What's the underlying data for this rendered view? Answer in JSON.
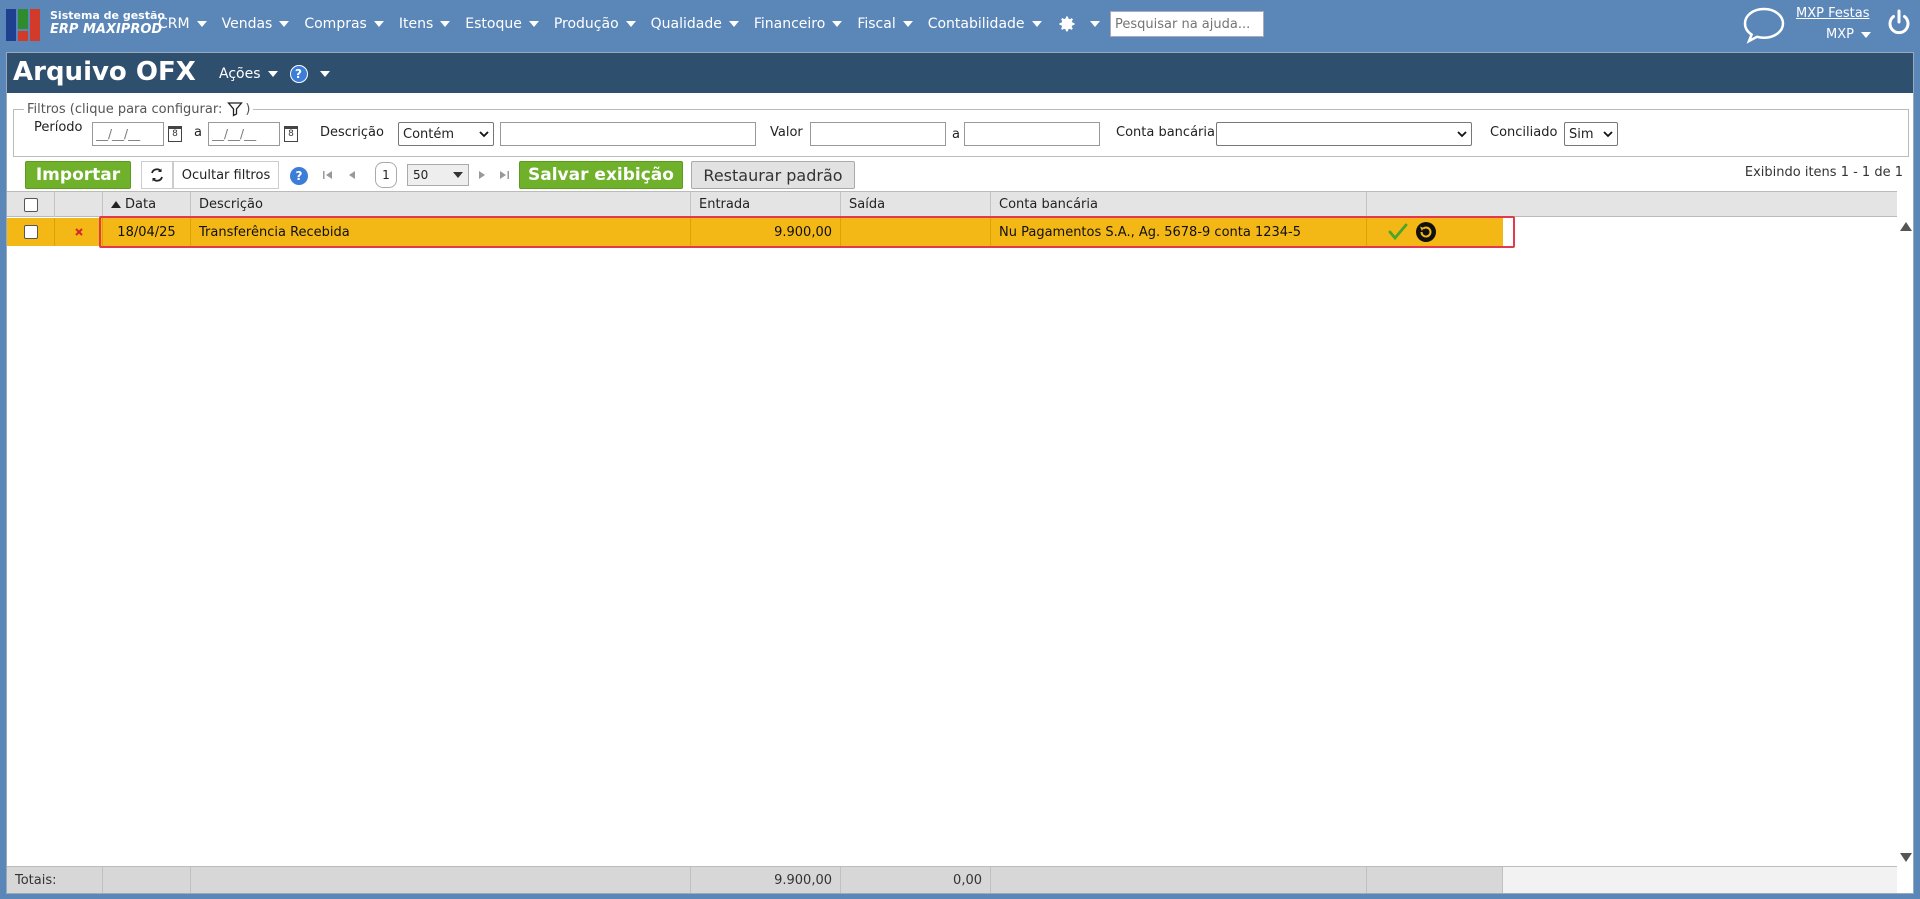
{
  "brand": {
    "line1": "Sistema de gestão",
    "line2": "ERP MAXIPROD"
  },
  "menu": [
    {
      "label": "CRM"
    },
    {
      "label": "Vendas"
    },
    {
      "label": "Compras"
    },
    {
      "label": "Itens"
    },
    {
      "label": "Estoque"
    },
    {
      "label": "Produção"
    },
    {
      "label": "Qualidade"
    },
    {
      "label": "Financeiro"
    },
    {
      "label": "Fiscal"
    },
    {
      "label": "Contabilidade"
    }
  ],
  "search": {
    "placeholder": "Pesquisar na ajuda..."
  },
  "user": {
    "name": "MXP Festas",
    "company": "MXP"
  },
  "page": {
    "title": "Arquivo OFX",
    "actions_label": "Ações",
    "help_glyph": "?"
  },
  "filters": {
    "legend": "Filtros (clique para configurar:",
    "legend_close": ")",
    "period_label": "Período",
    "date_placeholder": "__/__/__",
    "to_label": "a",
    "description_label": "Descrição",
    "description_mode": "Contém",
    "description_value": "",
    "value_label": "Valor",
    "value_from": "",
    "value_to": "",
    "account_label": "Conta bancária",
    "account_value": "",
    "reconciled_label": "Conciliado",
    "reconciled_value": "Sim"
  },
  "toolbar": {
    "import_label": "Importar",
    "hide_filters_label": "Ocultar filtros",
    "page_number": "1",
    "per_page": "50",
    "save_view_label": "Salvar exibição",
    "restore_label": "Restaurar padrão",
    "showing_text": "Exibindo itens 1 - 1 de 1"
  },
  "grid": {
    "columns": {
      "date": "Data",
      "description": "Descrição",
      "inflow": "Entrada",
      "outflow": "Saída",
      "account": "Conta bancária"
    },
    "rows": [
      {
        "date": "18/04/25",
        "description": "Transferência Recebida",
        "inflow": "9.900,00",
        "outflow": "",
        "account": "Nu Pagamentos S.A., Ag. 5678-9 conta 1234-5"
      }
    ],
    "totals": {
      "label": "Totais:",
      "inflow": "9.900,00",
      "outflow": "0,00"
    }
  },
  "colors": {
    "topbar": "#5b86b8",
    "title_bar": "#2f4f6f",
    "accent_green": "#6fb12b",
    "row_highlight": "#f4b816",
    "outline_red": "#e23a4a"
  }
}
